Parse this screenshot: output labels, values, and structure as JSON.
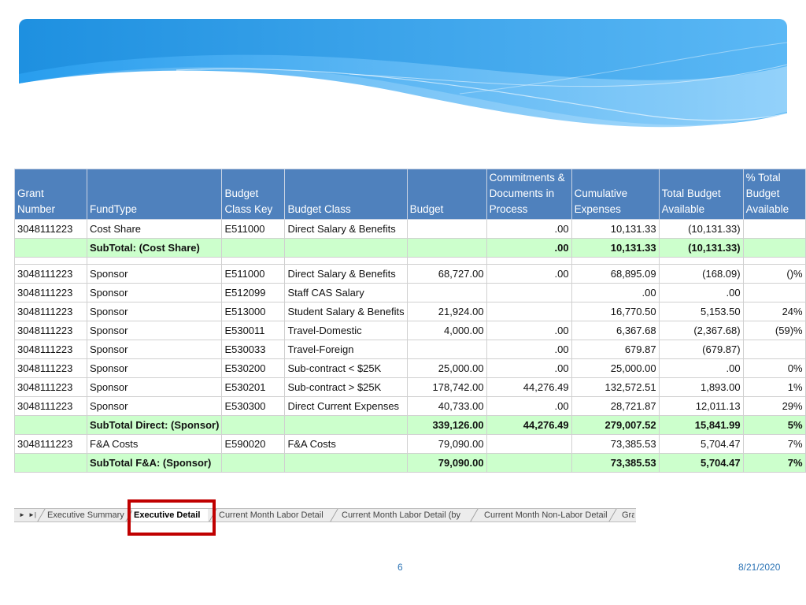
{
  "colors": {
    "header_bg": "#4f81bd",
    "subtotal_bg": "#ccffcc",
    "highlight": "#c00000",
    "footer_text": "#2e75b6"
  },
  "table": {
    "headers": [
      "Grant Number",
      "FundType",
      "Budget Class Key",
      "Budget Class",
      "Budget",
      "Commitments & Documents in Process",
      "Cumulative Expenses",
      "Total Budget Available",
      "% Total Budget Available"
    ],
    "header_lines": [
      [
        "Grant Number"
      ],
      [
        "FundType"
      ],
      [
        "Budget",
        "Class Key"
      ],
      [
        "Budget Class"
      ],
      [
        "Budget"
      ],
      [
        "Commitments &",
        "Documents in",
        "Process"
      ],
      [
        "Cumulative",
        "Expenses"
      ],
      [
        "Total Budget",
        "Available"
      ],
      [
        "% Total",
        "Budget",
        "Available"
      ]
    ],
    "rows": [
      {
        "kind": "data",
        "cells": [
          "3048111223",
          "Cost Share",
          "E511000",
          "Direct Salary & Benefits",
          "",
          ".00",
          "10,131.33",
          "(10,131.33)",
          ""
        ]
      },
      {
        "kind": "sub",
        "cells": [
          "",
          "SubTotal: (Cost Share)",
          "",
          "",
          "",
          ".00",
          "10,131.33",
          "(10,131.33)",
          ""
        ]
      },
      {
        "kind": "gap",
        "cells": [
          "",
          "",
          "",
          "",
          "",
          "",
          "",
          "",
          ""
        ]
      },
      {
        "kind": "data",
        "cells": [
          "3048111223",
          "Sponsor",
          "E511000",
          "Direct Salary & Benefits",
          "68,727.00",
          ".00",
          "68,895.09",
          "(168.09)",
          "()%"
        ]
      },
      {
        "kind": "data",
        "cells": [
          "3048111223",
          "Sponsor",
          "E512099",
          "Staff CAS Salary",
          "",
          "",
          ".00",
          ".00",
          ""
        ]
      },
      {
        "kind": "data",
        "cells": [
          "3048111223",
          "Sponsor",
          "E513000",
          "Student Salary & Benefits",
          "21,924.00",
          "",
          "16,770.50",
          "5,153.50",
          "24%"
        ]
      },
      {
        "kind": "data",
        "cells": [
          "3048111223",
          "Sponsor",
          "E530011",
          "Travel-Domestic",
          "4,000.00",
          ".00",
          "6,367.68",
          "(2,367.68)",
          "(59)%"
        ]
      },
      {
        "kind": "data",
        "cells": [
          "3048111223",
          "Sponsor",
          "E530033",
          "Travel-Foreign",
          "",
          ".00",
          "679.87",
          "(679.87)",
          ""
        ]
      },
      {
        "kind": "data",
        "cells": [
          "3048111223",
          "Sponsor",
          "E530200",
          "Sub-contract < $25K",
          "25,000.00",
          ".00",
          "25,000.00",
          ".00",
          "0%"
        ]
      },
      {
        "kind": "data",
        "cells": [
          "3048111223",
          "Sponsor",
          "E530201",
          "Sub-contract > $25K",
          "178,742.00",
          "44,276.49",
          "132,572.51",
          "1,893.00",
          "1%"
        ]
      },
      {
        "kind": "data",
        "cells": [
          "3048111223",
          "Sponsor",
          "E530300",
          "Direct Current Expenses",
          "40,733.00",
          ".00",
          "28,721.87",
          "12,011.13",
          "29%"
        ]
      },
      {
        "kind": "sub",
        "cells": [
          "",
          "SubTotal Direct: (Sponsor)",
          "",
          "",
          "339,126.00",
          "44,276.49",
          "279,007.52",
          "15,841.99",
          "5%"
        ]
      },
      {
        "kind": "data",
        "cells": [
          "3048111223",
          "F&A Costs",
          "E590020",
          "F&A Costs",
          "79,090.00",
          "",
          "73,385.53",
          "5,704.47",
          "7%"
        ]
      },
      {
        "kind": "sub",
        "cells": [
          "",
          "SubTotal F&A: (Sponsor)",
          "",
          "",
          "79,090.00",
          "",
          "73,385.53",
          "5,704.47",
          "7%"
        ]
      }
    ]
  },
  "sheet_tabs": [
    "Executive Summary",
    "Executive Detail",
    "Current Month Labor Detail",
    "Current Month Labor Detail (by",
    "Current Month Non-Labor Detail",
    "Gra"
  ],
  "active_tab": "Executive Detail",
  "nav_icons": [
    "scroll-prev-icon",
    "scroll-last-icon"
  ],
  "footer": {
    "page_number": "6",
    "date": "8/21/2020"
  }
}
